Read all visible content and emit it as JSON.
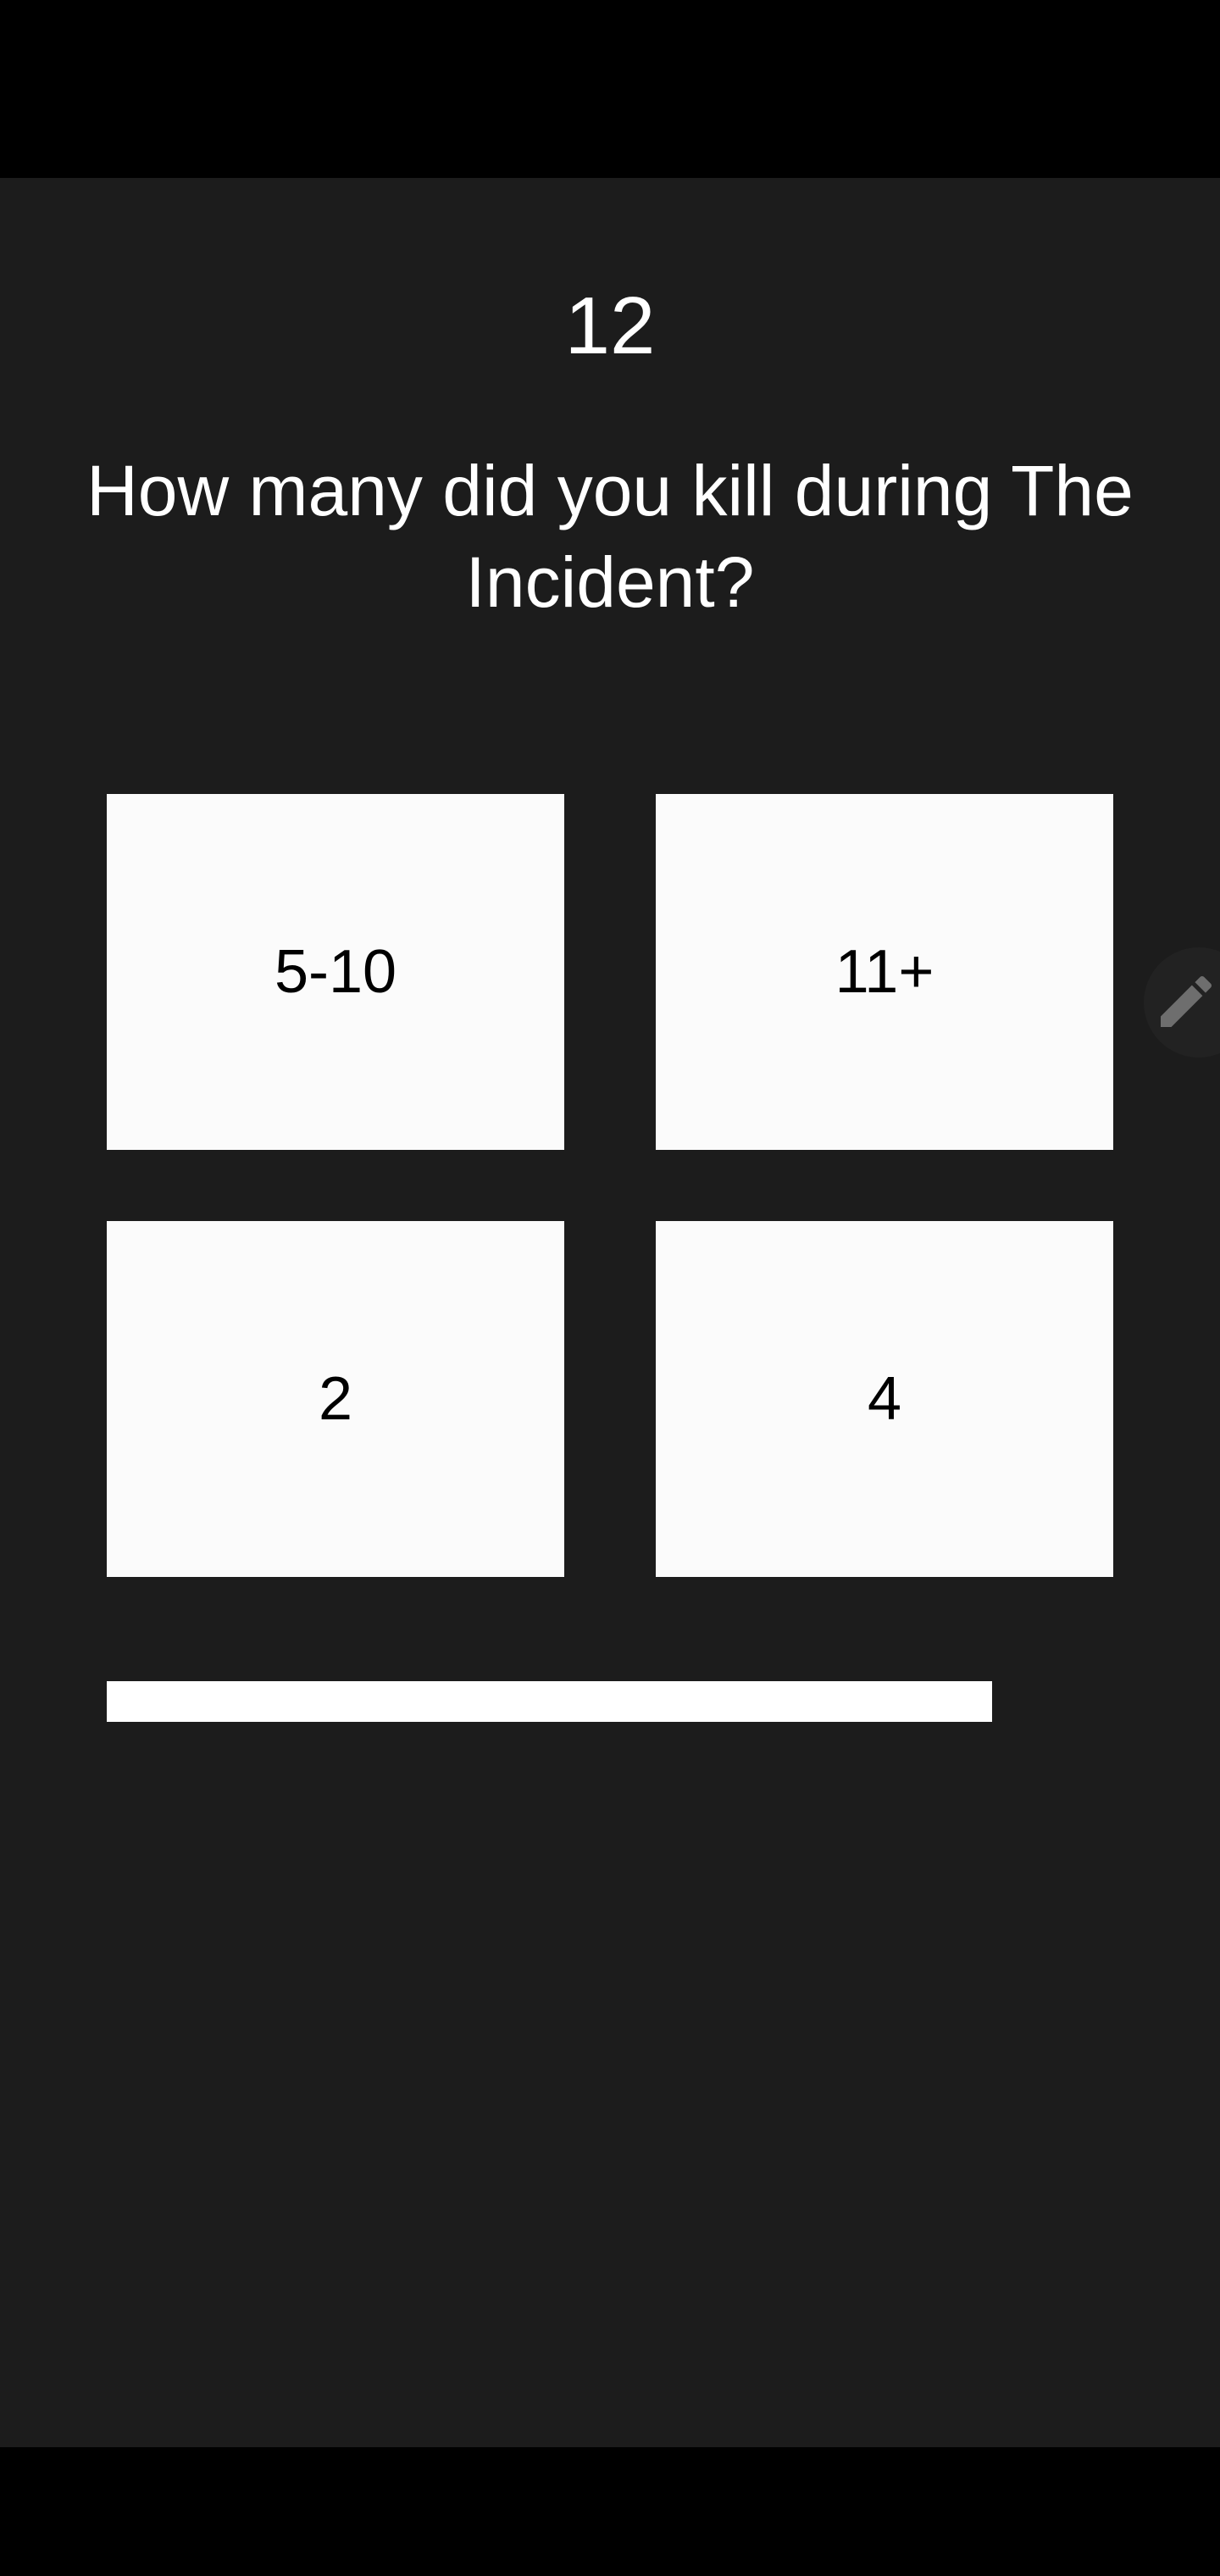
{
  "quiz": {
    "question_number": "12",
    "question": "How many did you kill during The Incident?",
    "answers": [
      "5-10",
      "11+",
      "2",
      "4"
    ],
    "progress": 0.88
  },
  "icons": {
    "edit": "pencil-icon"
  },
  "colors": {
    "background": "#1c1c1c",
    "system_bars": "#000000",
    "answer_tile": "#fbfbfb",
    "text_light": "#ffffff",
    "text_dark": "#000000"
  }
}
